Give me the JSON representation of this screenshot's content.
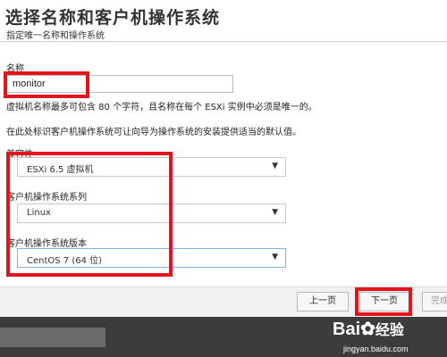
{
  "header": {
    "title": "选择名称和客户机操作系统",
    "subtitle": "指定唯一名称和操作系统"
  },
  "name": {
    "label": "名称",
    "value": "monitor",
    "hint": "虚拟机名称最多可包含 80 个字符，且名称在每个 ESXi 实例中必须是唯一的。"
  },
  "os_hint": "在此处标识客户机操作系统可让向导为操作系统的安装提供适当的默认值。",
  "compatibility": {
    "label": "兼容性",
    "value": "ESXi 6.5 虚拟机"
  },
  "os_family": {
    "label": "客户机操作系统系列",
    "value": "Linux"
  },
  "os_version": {
    "label": "客户机操作系统版本",
    "value": "CentOS 7 (64 位)"
  },
  "footer": {
    "back": "上一页",
    "next": "下一页",
    "finish": "完成"
  },
  "watermark": {
    "brand": "Bai",
    "brand2": "经验",
    "url": "jingyan.baidu.com"
  },
  "colors": {
    "highlight": "#e3141b",
    "focus_border": "#7fb4e6"
  }
}
